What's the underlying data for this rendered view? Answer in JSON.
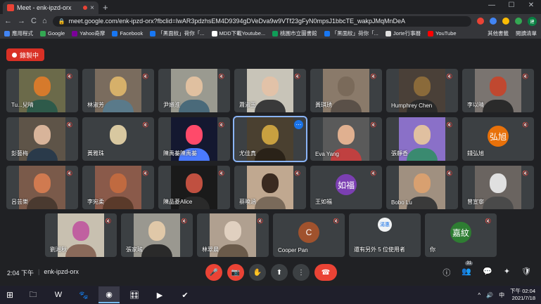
{
  "browser": {
    "tab_title": "Meet - enk-ipzd-orx",
    "tab_close": "×",
    "new_tab": "+",
    "window_controls": [
      "—",
      "☐",
      "✕"
    ],
    "nav": {
      "back": "←",
      "forward": "→",
      "reload": "C",
      "home": "⌂"
    },
    "url": "meet.google.com/enk-ipzd-orx?fbclid=IwAR3pdzhsEM4D9394gDVeDva9w9VTf23gFyN0mpsJ1bbcTE_wakpJMqMnDeA",
    "profile_initial": "建",
    "bookmarks": [
      {
        "label": "應用程式",
        "color": "#4285f4"
      },
      {
        "label": "Google",
        "color": "#34a853"
      },
      {
        "label": "Yahoo奇摩",
        "color": "#7b0099"
      },
      {
        "label": "Facebook",
        "color": "#1877f2"
      },
      {
        "label": "「黑面紋」荷你「...",
        "color": "#1877f2"
      },
      {
        "label": "MDD下載Youtube...",
        "color": "#ffffff"
      },
      {
        "label": "桃園市立圖書館",
        "color": "#0f9d58"
      },
      {
        "label": "「黑面紋」荷你「...",
        "color": "#1877f2"
      },
      {
        "label": "Jorte行事曆",
        "color": "#e0e0e0"
      },
      {
        "label": "YouTube",
        "color": "#ff0000"
      }
    ],
    "bookmarks_right": [
      "其他書籤",
      "閱讀清單"
    ]
  },
  "meet": {
    "recording_label": "錄製中",
    "participants": [
      {
        "name": "Tu...兒晴",
        "bg": "#6b6a4a",
        "face": "#d67a2c",
        "body": "#2e5a4a"
      },
      {
        "name": "林淑芳",
        "bg": "#7a6c5e",
        "face": "#d6b06a",
        "body": "#5a7a8a"
      },
      {
        "name": "尹嬿淮",
        "bg": "#9a9a90",
        "face": "#e0c0a0",
        "body": "#4a6a7a"
      },
      {
        "name": "蕭淑玉",
        "bg": "#c8c4b8",
        "face": "#e2c2a8",
        "body": "#3a3a3a"
      },
      {
        "name": "黃琪琇",
        "bg": "#8a7a6a",
        "face": "#7a6a5a",
        "body": "#5a5048"
      },
      {
        "name": "Humphrey Chen",
        "bg": "#4a4038",
        "face": "#8a6a3a",
        "body": "#2a2a2a"
      },
      {
        "name": "李以晴",
        "bg": "#7a7470",
        "face": "#c04830",
        "body": "#2a2a2a"
      },
      {
        "name": "彭藝梅",
        "bg": "#5e5448",
        "face": "#d8b49a",
        "body": "#2a3a4a"
      },
      {
        "name": "黃雅珠",
        "bg": "#3c4043",
        "face": "#d8c8a0",
        "body": "#3c4043"
      },
      {
        "name": "陳禹蓁陳禹蓁",
        "bg": "#141830",
        "face": "#ff4a6a",
        "body": "#4a7aff"
      },
      {
        "name": "尤佳真",
        "bg": "#4a4030",
        "face": "#c8a040",
        "body": "#2a2218"
      },
      {
        "name": "Eva Yang",
        "bg": "#5a5a5a",
        "face": "#e0b090",
        "body": "#c04040"
      },
      {
        "name": "張靜香",
        "bg": "#8a70c8",
        "face": "#e0c0a0",
        "body": "#3a8a70"
      },
      {
        "name": "錢弘旭",
        "bg": "#3c4043",
        "initial": "弘旭",
        "avatar_color": "#e8710a"
      },
      {
        "name": "呂芸樂",
        "bg": "#7a5a4a",
        "face": "#d07a50",
        "body": "#4a3a30"
      },
      {
        "name": "李宛柔",
        "bg": "#8a5a4a",
        "face": "#c06a40",
        "body": "#5a3a2a"
      },
      {
        "name": "陳品菱Alice",
        "bg": "#1a1a1a",
        "face": "#c05040",
        "body": "#2a2a2a"
      },
      {
        "name": "蔡曉涵",
        "bg": "#c0a890",
        "face": "#3a2a20",
        "body": "#7a6a5a"
      },
      {
        "name": "王如福",
        "bg": "#3c4043",
        "initial": "如福",
        "avatar_color": "#7b3fb2"
      },
      {
        "name": "Bobo Lu",
        "bg": "#a09080",
        "face": "#d8a070",
        "body": "#3a3a3a"
      },
      {
        "name": "曾宣寧",
        "bg": "#6a6460",
        "face": "#e0e0e0",
        "body": "#4a4a4a"
      },
      {
        "name": "劉湘秋",
        "bg": "#c8c0b0",
        "face": "#c060a0",
        "body": "#8a6a5a"
      },
      {
        "name": "張家瑤",
        "bg": "#9a9890",
        "face": "#e0c8a8",
        "body": "#2a2a2a"
      },
      {
        "name": "林翠晨",
        "bg": "#b0a090",
        "face": "#e0d0c0",
        "body": "#6a5a4a"
      },
      {
        "name": "Cooper Pan",
        "bg": "#3c4043",
        "initial": "C",
        "avatar_color": "#a0522d"
      },
      {
        "name": "還有另外 5 位使用者",
        "bg": "#3c4043",
        "others": true,
        "mini": "湯惠"
      },
      {
        "name": "你",
        "bg": "#3c4043",
        "initial": "嘉紋",
        "avatar_color": "#2e7d32"
      }
    ],
    "time": "2:04 下午",
    "separator": "|",
    "meeting_code": "enk-ipzd-orx",
    "participant_count": "31",
    "controls": {
      "mic": "🎤",
      "camera": "📷",
      "hand": "✋",
      "present": "⬆",
      "more": "⋮",
      "end": "☎"
    },
    "right_controls": {
      "info": "ⓘ",
      "people": "👥",
      "chat": "💬",
      "activities": "✦",
      "host": "🛡"
    },
    "more_dots": "⋯",
    "mic_off": "🔇"
  },
  "taskbar": {
    "start": "⊞",
    "tasks": [
      "🗀",
      "W",
      "🐾",
      "◉",
      "🎛",
      "▶",
      "✔"
    ],
    "tray_icons": [
      "^",
      "🔊",
      "中"
    ],
    "clock_time": "下午 02:04",
    "clock_date": "2021/7/18"
  }
}
